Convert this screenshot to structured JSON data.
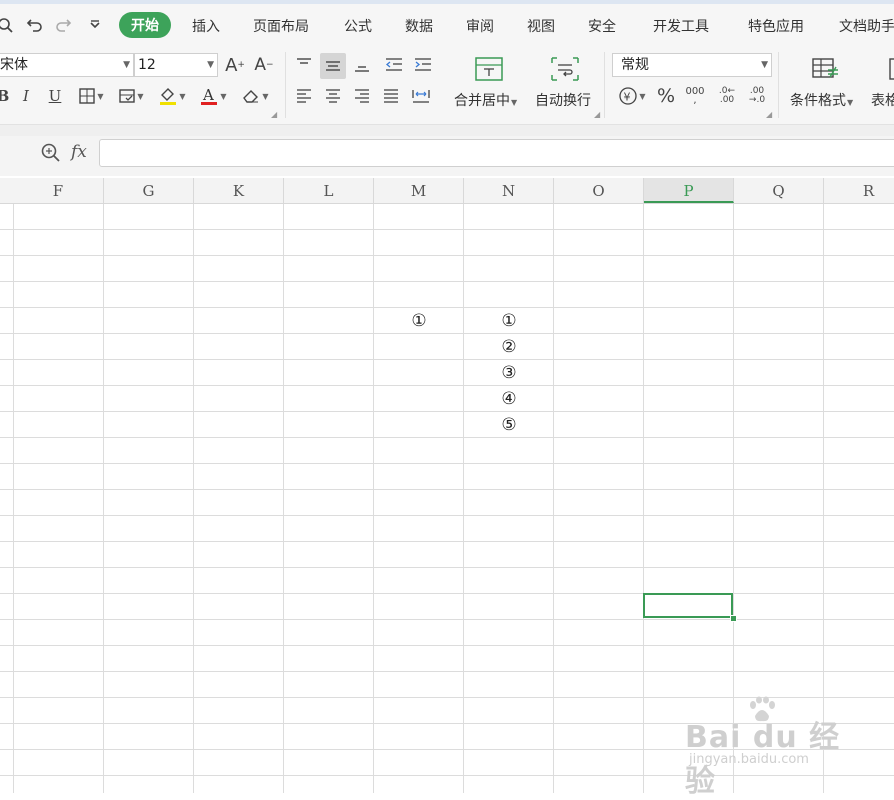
{
  "menu": {
    "tabs": [
      "开始",
      "插入",
      "页面布局",
      "公式",
      "数据",
      "审阅",
      "视图",
      "安全",
      "开发工具",
      "特色应用",
      "文档助手"
    ]
  },
  "ribbon": {
    "font_name": "宋体",
    "font_size": "12",
    "merge_center_label": "合并居中",
    "wrap_text_label": "自动换行",
    "number_format": "常规",
    "cond_format_label": "条件格式",
    "table_style_label": "表格"
  },
  "formula_bar": {
    "fx_label": "fx",
    "value": ""
  },
  "sheet": {
    "columns": [
      "F",
      "G",
      "K",
      "L",
      "M",
      "N",
      "O",
      "P",
      "Q",
      "R"
    ],
    "active_column": "P",
    "cells": {
      "M_row5": "①",
      "N_row5": "①",
      "N_row6": "②",
      "N_row7": "③",
      "N_row8": "④",
      "N_row9": "⑤"
    }
  },
  "watermark": {
    "brand": "Bai du 经验",
    "url": "jingyan.baidu.com"
  },
  "colors": {
    "accent": "#3da35a",
    "selection": "#3a9a55",
    "font_color_bar": "#e02020",
    "fill_color_bar": "#f0e000"
  }
}
